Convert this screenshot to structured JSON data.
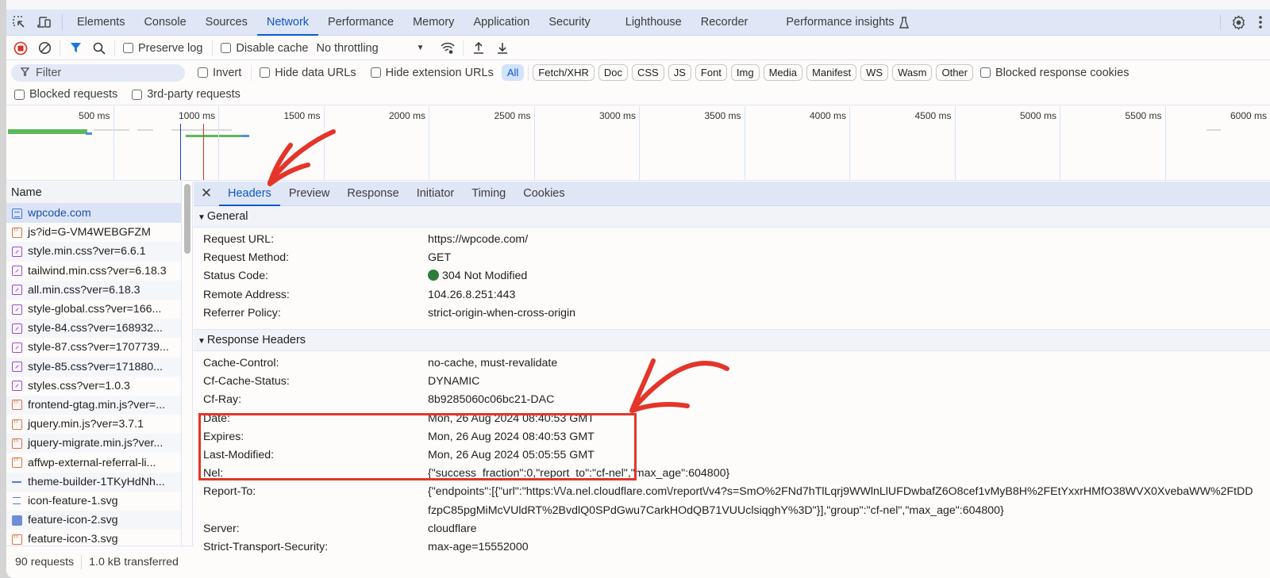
{
  "tabbar": {
    "tabs": [
      "Elements",
      "Console",
      "Sources",
      "Network",
      "Performance",
      "Memory",
      "Application",
      "Security",
      "Lighthouse",
      "Recorder",
      "Performance insights"
    ],
    "active": "Network",
    "icons": [
      "inspect-element-icon",
      "device-toolbar-icon",
      "flask-icon",
      "gear-icon",
      "more-vertical-icon"
    ]
  },
  "toolbar": {
    "preserve_log": "Preserve log",
    "disable_cache": "Disable cache",
    "throttling": "No throttling"
  },
  "filter": {
    "placeholder": "Filter",
    "invert": "Invert",
    "hide_data_urls": "Hide data URLs",
    "hide_extension_urls": "Hide extension URLs",
    "types": [
      "All",
      "Fetch/XHR",
      "Doc",
      "CSS",
      "JS",
      "Font",
      "Img",
      "Media",
      "Manifest",
      "WS",
      "Wasm",
      "Other"
    ],
    "active_type": "All",
    "blocked_response_cookies": "Blocked response cookies",
    "blocked_requests": "Blocked requests",
    "third_party_requests": "3rd-party requests"
  },
  "overview": {
    "ticks": [
      "500 ms",
      "1000 ms",
      "1500 ms",
      "2000 ms",
      "2500 ms",
      "3000 ms",
      "3500 ms",
      "4000 ms",
      "4500 ms",
      "5000 ms",
      "5500 ms",
      "6000 ms"
    ],
    "dom_content_loaded_ms": 940,
    "load_ms": 1050
  },
  "requests": {
    "header": "Name",
    "items": [
      {
        "name": "wpcode.com",
        "type": "doc"
      },
      {
        "name": "js?id=G-VM4WEBGFZM",
        "type": "js"
      },
      {
        "name": "style.min.css?ver=6.6.1",
        "type": "css"
      },
      {
        "name": "tailwind.min.css?ver=6.18.3",
        "type": "css"
      },
      {
        "name": "all.min.css?ver=6.18.3",
        "type": "css"
      },
      {
        "name": "style-global.css?ver=166...",
        "type": "css"
      },
      {
        "name": "style-84.css?ver=168932...",
        "type": "css"
      },
      {
        "name": "style-87.css?ver=1707739...",
        "type": "css"
      },
      {
        "name": "style-85.css?ver=171880...",
        "type": "css"
      },
      {
        "name": "styles.css?ver=1.0.3",
        "type": "css"
      },
      {
        "name": "frontend-gtag.min.js?ver=...",
        "type": "js"
      },
      {
        "name": "jquery.min.js?ver=3.7.1",
        "type": "js"
      },
      {
        "name": "jquery-migrate.min.js?ver...",
        "type": "js"
      },
      {
        "name": "affwp-external-referral-li...",
        "type": "js"
      },
      {
        "name": "theme-builder-1TKyHdNh...",
        "type": "ws"
      },
      {
        "name": "icon-feature-1.svg",
        "type": "svg1"
      },
      {
        "name": "feature-icon-2.svg",
        "type": "svg2"
      },
      {
        "name": "feature-icon-3.svg",
        "type": "js"
      }
    ],
    "count": "90 requests",
    "transferred": "1.0 kB transferred"
  },
  "details": {
    "tabs": [
      "Headers",
      "Preview",
      "Response",
      "Initiator",
      "Timing",
      "Cookies"
    ],
    "active_tab": "Headers",
    "general": {
      "title": "General",
      "rows": [
        {
          "k": "Request URL:",
          "v": "https://wpcode.com/"
        },
        {
          "k": "Request Method:",
          "v": "GET"
        },
        {
          "k": "Status Code:",
          "v": "304 Not Modified",
          "status_color": "#2f7d3b"
        },
        {
          "k": "Remote Address:",
          "v": "104.26.8.251:443"
        },
        {
          "k": "Referrer Policy:",
          "v": "strict-origin-when-cross-origin"
        }
      ]
    },
    "response": {
      "title": "Response Headers",
      "rows": [
        {
          "k": "Cache-Control:",
          "v": "no-cache, must-revalidate"
        },
        {
          "k": "Cf-Cache-Status:",
          "v": "DYNAMIC"
        },
        {
          "k": "Cf-Ray:",
          "v": "8b9285060c06bc21-DAC"
        },
        {
          "k": "Date:",
          "v": "Mon, 26 Aug 2024 08:40:53 GMT"
        },
        {
          "k": "Expires:",
          "v": "Mon, 26 Aug 2024 08:40:53 GMT"
        },
        {
          "k": "Last-Modified:",
          "v": "Mon, 26 Aug 2024 05:05:55 GMT"
        },
        {
          "k": "Nel:",
          "v": "{\"success_fraction\":0,\"report_to\":\"cf-nel\",\"max_age\":604800}"
        },
        {
          "k": "Report-To:",
          "v": "{\"endpoints\":[{\"url\":\"https:\\/\\/a.nel.cloudflare.com\\/report\\/v4?s=SmO%2FNd7hTlLqrj9WWlnLlUFDwbafZ6O8cef1vMyB8H%2FEtYxxrHMfO38WVX0XvebaWW%2FtDDfzpC85pgMiMcVUldRT%2BvdlQ0SPdGwu7CarkHOdQB71VUUclsiqghY%3D\"}],\"group\":\"cf-nel\",\"max_age\":604800}"
        },
        {
          "k": "Server:",
          "v": "cloudflare"
        },
        {
          "k": "Strict-Transport-Security:",
          "v": "max-age=15552000"
        }
      ]
    }
  },
  "annotations": {
    "highlight_color": "#e5342a"
  }
}
